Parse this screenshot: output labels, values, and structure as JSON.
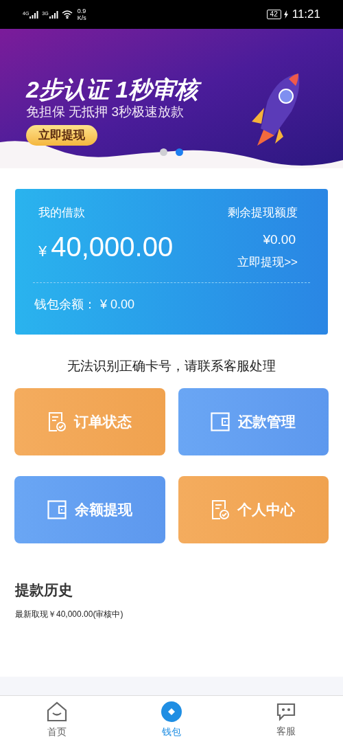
{
  "status_bar": {
    "network_1": "4G",
    "network_2": "3G",
    "speed_value": "0.9",
    "speed_unit": "K/s",
    "battery": "42",
    "time": "11:21"
  },
  "banner": {
    "title": "2步认证 1秒审核",
    "subtitle": "免担保 无抵押 3秒极速放款",
    "button": "立即提现",
    "dots": [
      {
        "selected": false
      },
      {
        "selected": true
      }
    ]
  },
  "loan_card": {
    "label": "我的借款",
    "amount": "40,000.00",
    "currency": "¥",
    "quota_label": "剩余提现额度",
    "quota_value": "¥0.00",
    "withdraw_link": "立即提现>>",
    "wallet_label": "钱包余额：",
    "wallet_currency": "¥",
    "wallet_value": "0.00"
  },
  "notice": "无法识别正确卡号，请联系客服处理",
  "tiles": [
    {
      "kind": "order",
      "label": "订单状态"
    },
    {
      "kind": "wallet",
      "label": "还款管理"
    },
    {
      "kind": "wallet",
      "label": "余额提现"
    },
    {
      "kind": "order",
      "label": "个人中心"
    }
  ],
  "history": {
    "title": "提款历史",
    "entries": [
      "最新取现￥40,000.00(审核中)"
    ]
  },
  "tab_bar": [
    {
      "kind": "home",
      "label": "首页",
      "selected": false
    },
    {
      "kind": "wallet",
      "label": "钱包",
      "selected": true
    },
    {
      "kind": "service",
      "label": "客服",
      "selected": false
    }
  ]
}
